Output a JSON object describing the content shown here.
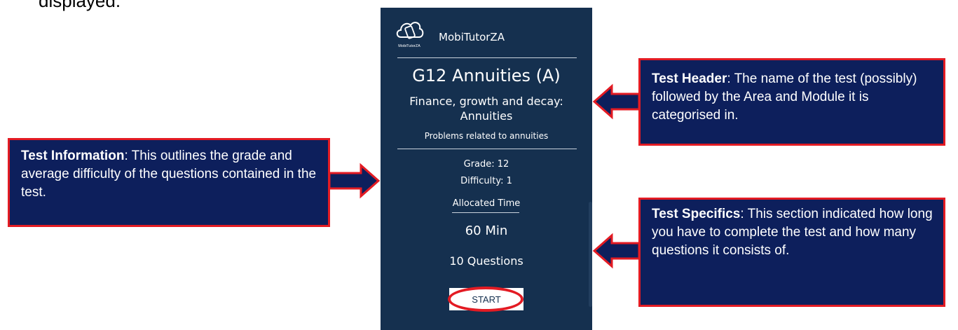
{
  "doc": {
    "top_text_fragment": "displayed."
  },
  "app": {
    "name": "MobiTutorZA",
    "logo_caption": "MobiTutorZA"
  },
  "test": {
    "title": "G12 Annuities (A)",
    "area_line1": "Finance, growth and decay:",
    "area_line2": "Annuities",
    "description": "Problems related to annuities",
    "grade": "Grade: 12",
    "difficulty": "Difficulty: 1",
    "allocated_label": "Allocated Time",
    "allocated_time": "60 Min",
    "questions": "10 Questions",
    "start_label": "START"
  },
  "callouts": {
    "header": {
      "title": "Test Header",
      "text": ":  The name of the test (possibly) followed by the Area and Module it is categorised in."
    },
    "info": {
      "title": "Test Information",
      "text": ":  This outlines the grade and average difficulty of the questions contained in the test."
    },
    "specifics": {
      "title": "Test Specifics",
      "text": ":  This section indicated how long you have to complete the test and how many questions it consists of."
    }
  },
  "colors": {
    "phone_bg": "#15304f",
    "callout_bg": "#0d1f5c",
    "callout_border": "#e31b23",
    "highlight_ring": "#e31b23"
  }
}
